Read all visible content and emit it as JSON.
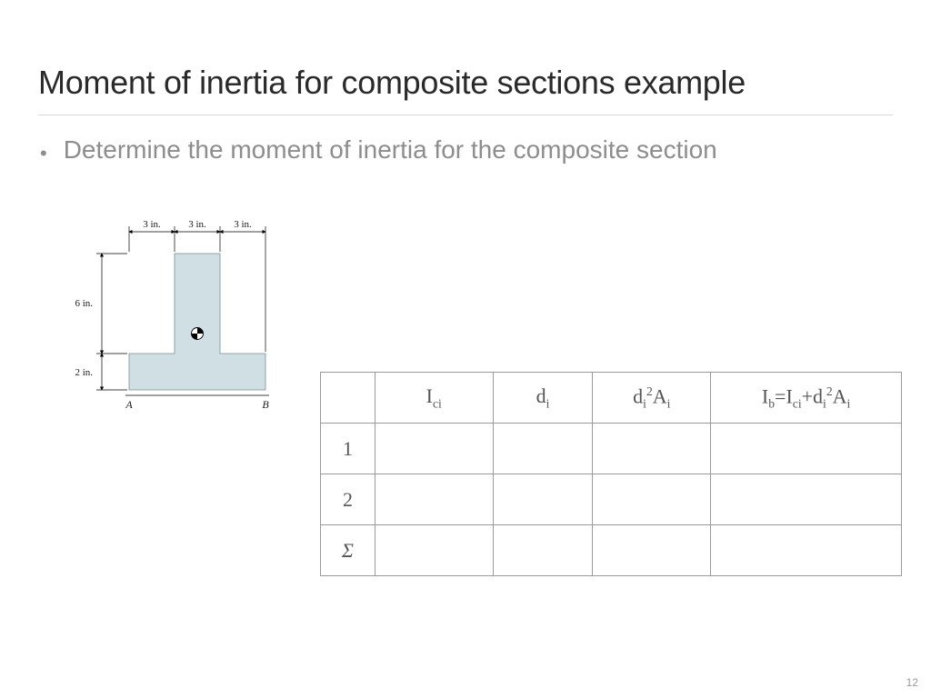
{
  "title": "Moment of inertia for composite sections example",
  "bullet": "Determine the moment of inertia for the composite section",
  "page_number": "12",
  "diagram": {
    "top_dims": [
      "3 in.",
      "3 in.",
      "3 in."
    ],
    "left_dims": [
      "6 in.",
      "2 in."
    ],
    "label_A": "A",
    "label_B": "B"
  },
  "table": {
    "headers": {
      "index": "",
      "ici_main": "I",
      "ici_sub": "ci",
      "di_main": "d",
      "di_sub": "i",
      "d2a_d": "d",
      "d2a_i1": "i",
      "d2a_2": "2",
      "d2a_A": "A",
      "d2a_i2": "i",
      "ib_I": "I",
      "ib_b": "b",
      "ib_eq": "=I",
      "ib_ci": "ci",
      "ib_plus": "+d",
      "ib_i1": "i",
      "ib_2": "2",
      "ib_A": "A",
      "ib_i2": "i"
    },
    "rows": [
      "1",
      "2",
      "Σ"
    ]
  }
}
